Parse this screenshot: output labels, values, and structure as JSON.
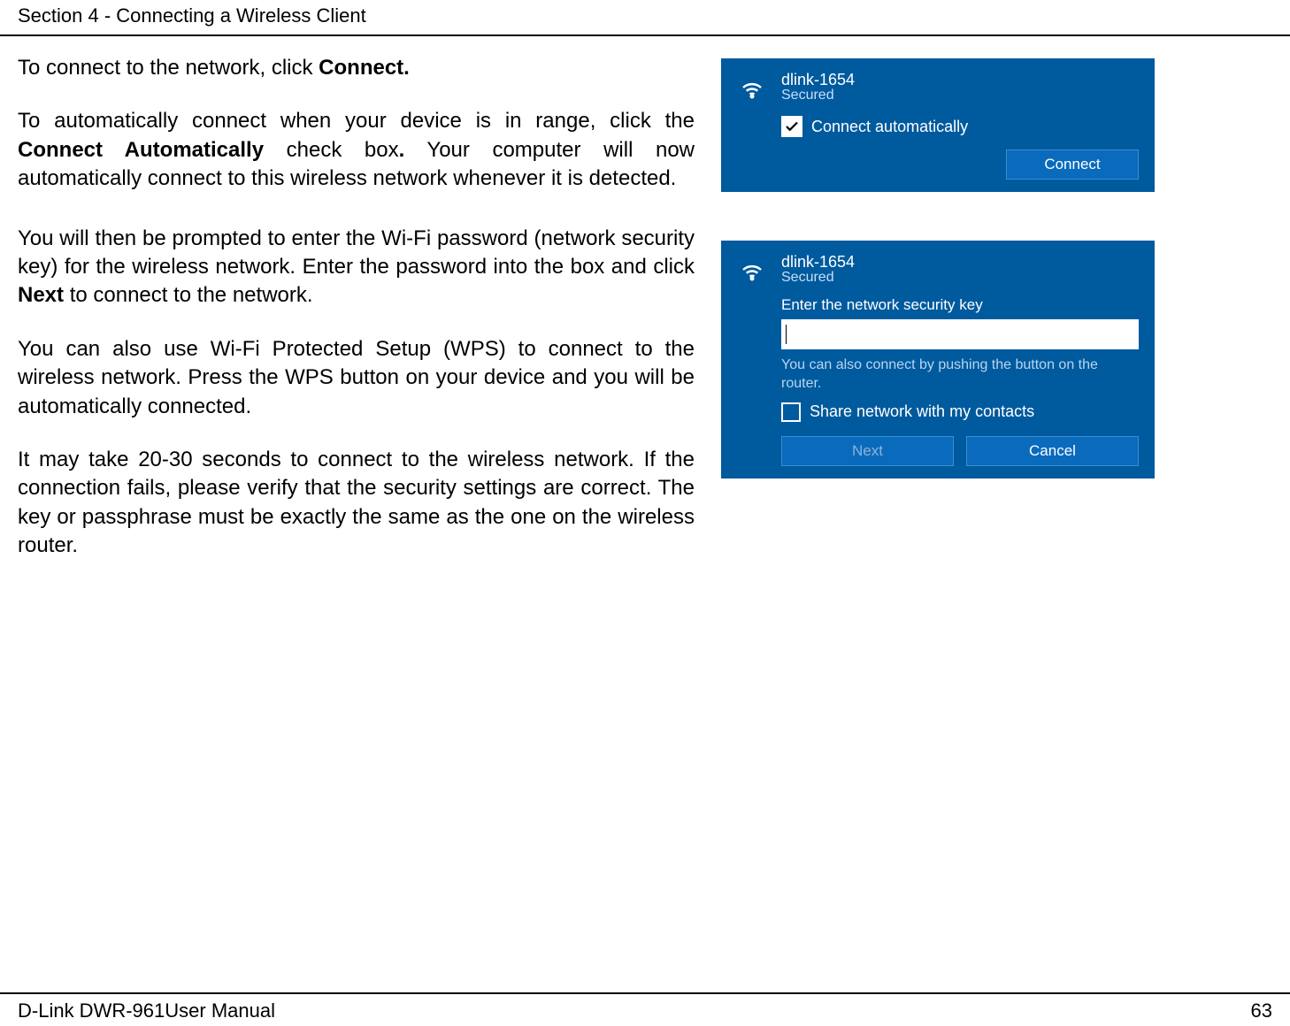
{
  "header": "Section 4 - Connecting a Wireless Client",
  "para1_a": "To connect to the network, click ",
  "para1_b": "Connect.",
  "para2_a": "To automatically connect when your device is in range, click the ",
  "para2_b": "Connect Automatically",
  "para2_c": " check box",
  "para2_d": ".",
  "para2_e": " Your computer will now automatically connect to this wireless network whenever it is detected.",
  "para3_a": "You will then be prompted to enter the Wi-Fi password (network security key) for the wireless network. Enter the password into the box and click ",
  "para3_b": "Next",
  "para3_c": " to connect to the network.",
  "para4": "You can also use Wi-Fi Protected Setup (WPS) to connect to the wireless network. Press the WPS button on your device and you will be automatically connected.",
  "para5": "It may take 20-30 seconds to connect to the wireless network. If the connection fails, please verify that the security settings are correct. The key or passphrase must be exactly the same as the one on the wireless router.",
  "panel1": {
    "ssid": "dlink-1654",
    "status": "Secured",
    "chk_label": "Connect automatically",
    "connect": "Connect"
  },
  "panel2": {
    "ssid": "dlink-1654",
    "status": "Secured",
    "prompt": "Enter the network security key",
    "wps": "You can also connect by pushing the button on the router.",
    "share": "Share network with my contacts",
    "next": "Next",
    "cancel": "Cancel"
  },
  "footer_left": "D-Link DWR-961User Manual",
  "footer_right": "63"
}
